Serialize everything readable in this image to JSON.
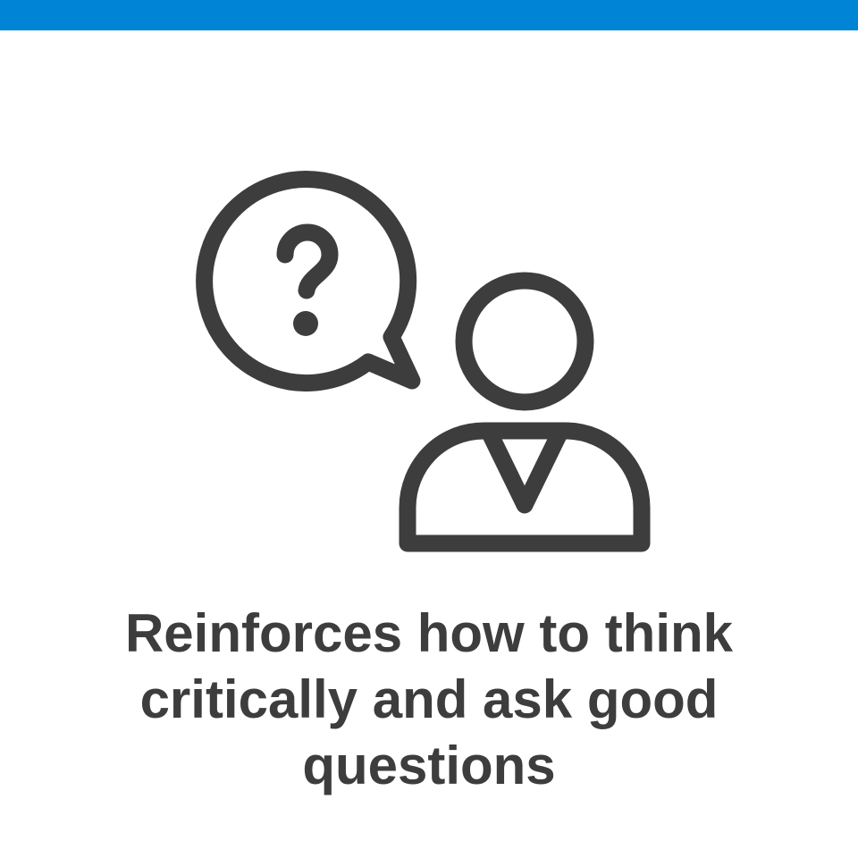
{
  "banner": {
    "color": "#0084d5"
  },
  "illustration": {
    "icons": [
      "speech-bubble-icon",
      "question-mark-icon",
      "person-icon"
    ],
    "stroke_color": "#3d3d3d"
  },
  "caption": {
    "text": "Reinforces how to think critically and ask good questions",
    "color": "#3d3d3d"
  }
}
